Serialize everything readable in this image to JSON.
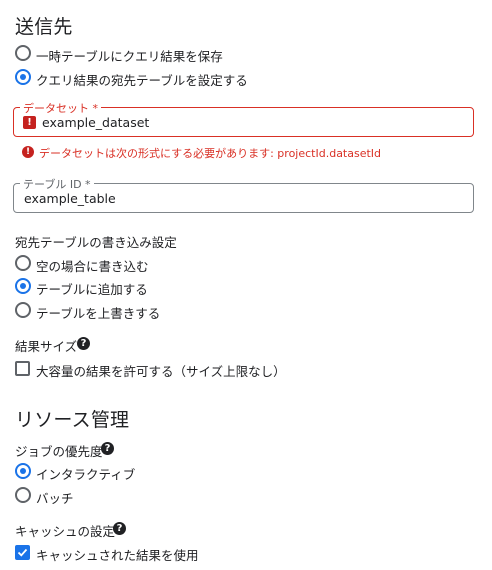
{
  "destination": {
    "heading": "送信先",
    "options": [
      {
        "label": "一時テーブルにクエリ結果を保存",
        "checked": false
      },
      {
        "label": "クエリ結果の宛先テーブルを設定する",
        "checked": true
      }
    ],
    "dataset_field": {
      "legend": "データセット",
      "required_mark": "*",
      "value": "example_dataset",
      "error_icon": "!",
      "error_message": "データセットは次の形式にする必要があります: projectId.datasetId"
    },
    "table_field": {
      "legend": "テーブル ID *",
      "value": "example_table"
    },
    "write_preference": {
      "label": "宛先テーブルの書き込み設定",
      "options": [
        {
          "label": "空の場合に書き込む",
          "checked": false
        },
        {
          "label": "テーブルに追加する",
          "checked": true
        },
        {
          "label": "テーブルを上書きする",
          "checked": false
        }
      ]
    },
    "result_size": {
      "label": "結果サイズ",
      "help": "?",
      "checkbox_label": "大容量の結果を許可する（サイズ上限なし）",
      "checked": false
    }
  },
  "resource_management": {
    "heading": "リソース管理",
    "job_priority": {
      "label": "ジョブの優先度",
      "help": "?",
      "options": [
        {
          "label": "インタラクティブ",
          "checked": true
        },
        {
          "label": "バッチ",
          "checked": false
        }
      ]
    },
    "cache": {
      "label": "キャッシュの設定",
      "help": "?",
      "checkbox_label": "キャッシュされた結果を使用",
      "checked": true
    }
  },
  "colors": {
    "accent": "#1a73e8",
    "error": "#d93025",
    "text": "#202124"
  },
  "icons": {
    "radio": "radio-icon",
    "checkbox": "checkbox-icon",
    "help": "help-circle-icon",
    "error": "error-icon"
  }
}
